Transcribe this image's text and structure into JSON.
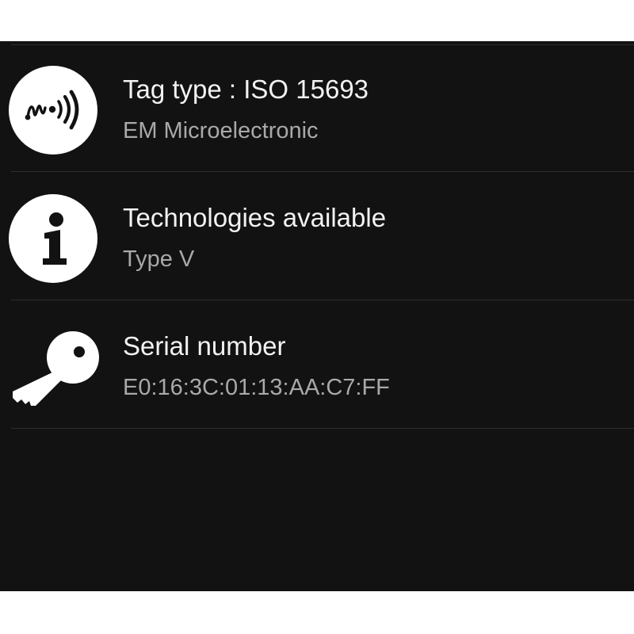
{
  "rows": [
    {
      "icon": "nfc-tag-icon",
      "title": "Tag type : ISO 15693",
      "subtitle": "EM Microelectronic"
    },
    {
      "icon": "info-icon",
      "title": "Technologies available",
      "subtitle": "Type V"
    },
    {
      "icon": "key-icon",
      "title": "Serial number",
      "subtitle": "E0:16:3C:01:13:AA:C7:FF"
    }
  ],
  "colors": {
    "background": "#121212",
    "title": "#f2f2f2",
    "subtitle": "#a9a9a9",
    "divider": "#2e2e2e",
    "icon": "#ffffff"
  }
}
